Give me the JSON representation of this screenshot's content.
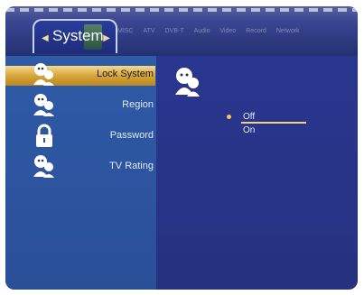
{
  "header": {
    "title": "System",
    "tabs": [
      "MISC",
      "ATV",
      "DVB-T",
      "Audio",
      "Video",
      "Record",
      "Network"
    ]
  },
  "sidebar": {
    "items": [
      {
        "label": "Lock System",
        "icon": "users-icon",
        "selected": true
      },
      {
        "label": "Region",
        "icon": "users-icon",
        "selected": false
      },
      {
        "label": "Password",
        "icon": "lock-icon",
        "selected": false
      },
      {
        "label": "TV Rating",
        "icon": "users-icon",
        "selected": false
      }
    ]
  },
  "main": {
    "icon": "users-icon",
    "options": [
      {
        "label": "Off",
        "selected": true
      },
      {
        "label": "On",
        "selected": false
      }
    ]
  },
  "colors": {
    "background": "#2a3792",
    "sidebar": "#2f5aa6",
    "selected": "#e0b04e",
    "text": "#eaeaf5"
  }
}
